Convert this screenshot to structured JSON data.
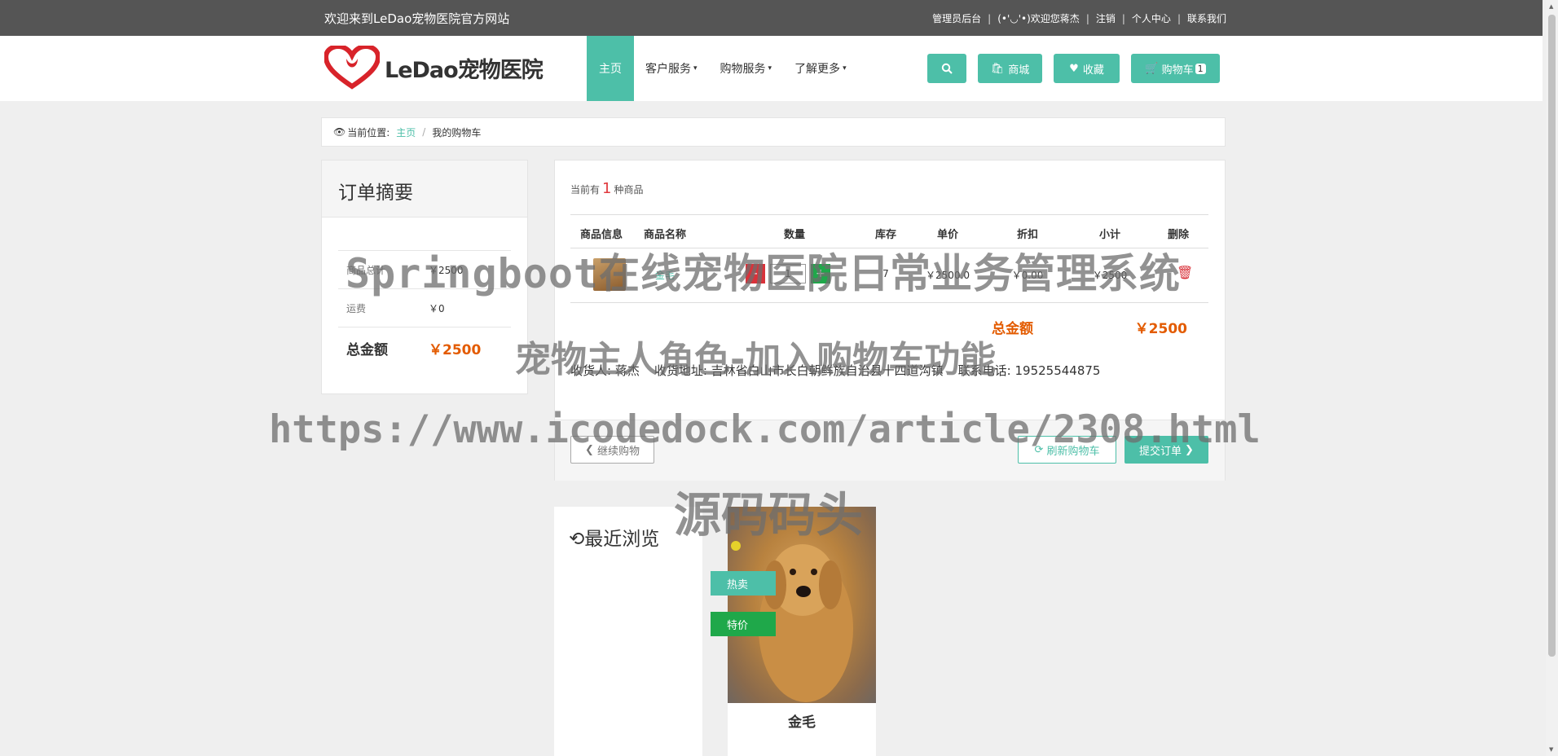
{
  "topbar": {
    "welcome": "欢迎来到LeDao宠物医院官方网站",
    "links": [
      "管理员后台",
      "(•'◡'•)欢迎您蒋杰",
      "注销",
      "个人中心",
      "联系我们"
    ],
    "separator": "|"
  },
  "navbar": {
    "logo_text": "LeDao宠物医院",
    "menu": [
      {
        "label": "主页",
        "active": true,
        "has_dropdown": false
      },
      {
        "label": "客户服务",
        "active": false,
        "has_dropdown": true
      },
      {
        "label": "购物服务",
        "active": false,
        "has_dropdown": true
      },
      {
        "label": "了解更多",
        "active": false,
        "has_dropdown": true
      }
    ],
    "buttons": {
      "search_icon": "search-icon",
      "mall": "商城",
      "favorites": "收藏",
      "cart": "购物车",
      "cart_count": "1"
    },
    "accent_color": "#4dbfa8"
  },
  "breadcrumb": {
    "prefix": "当前位置:",
    "home": "主页",
    "separator": "/",
    "current": "我的购物车"
  },
  "summary": {
    "title": "订单摘要",
    "rows": [
      {
        "label": "商品总计",
        "value": "￥2500"
      },
      {
        "label": "运费",
        "value": "￥0"
      }
    ],
    "total_label": "总金额",
    "total_value": "￥2500"
  },
  "cart": {
    "count_prefix": "当前有",
    "count": "1",
    "count_suffix": "种商品",
    "headers": [
      "商品信息",
      "商品名称",
      "数量",
      "库存",
      "单价",
      "折扣",
      "小计",
      "删除"
    ],
    "item": {
      "name": "金毛",
      "quantity": "1",
      "minus": "-",
      "plus": "+",
      "stock": "7",
      "price": "￥2500.0",
      "discount": "￥0.00",
      "subtotal": "￥2500"
    },
    "total_label": "总金额",
    "total_value": "￥2500",
    "receiver": "收货人: 蒋杰",
    "address": "收货地址: 吉林省白山市长白朝鲜族自治县十四道沟镇",
    "phone": "联系电话: 19525544875",
    "continue_button": "继续购物",
    "refresh_button": "刷新购物车",
    "submit_button": "提交订单"
  },
  "recent": {
    "title": "最近浏览",
    "product_name": "金毛",
    "tags": [
      "热卖",
      "特价"
    ]
  },
  "watermark": {
    "line1": "Springboot在线宠物医院日常业务管理系统",
    "line2": "宠物主人角色-加入购物车功能",
    "line3": "https://www.icodedock.com/article/2308.html",
    "line4": "源码码头"
  }
}
